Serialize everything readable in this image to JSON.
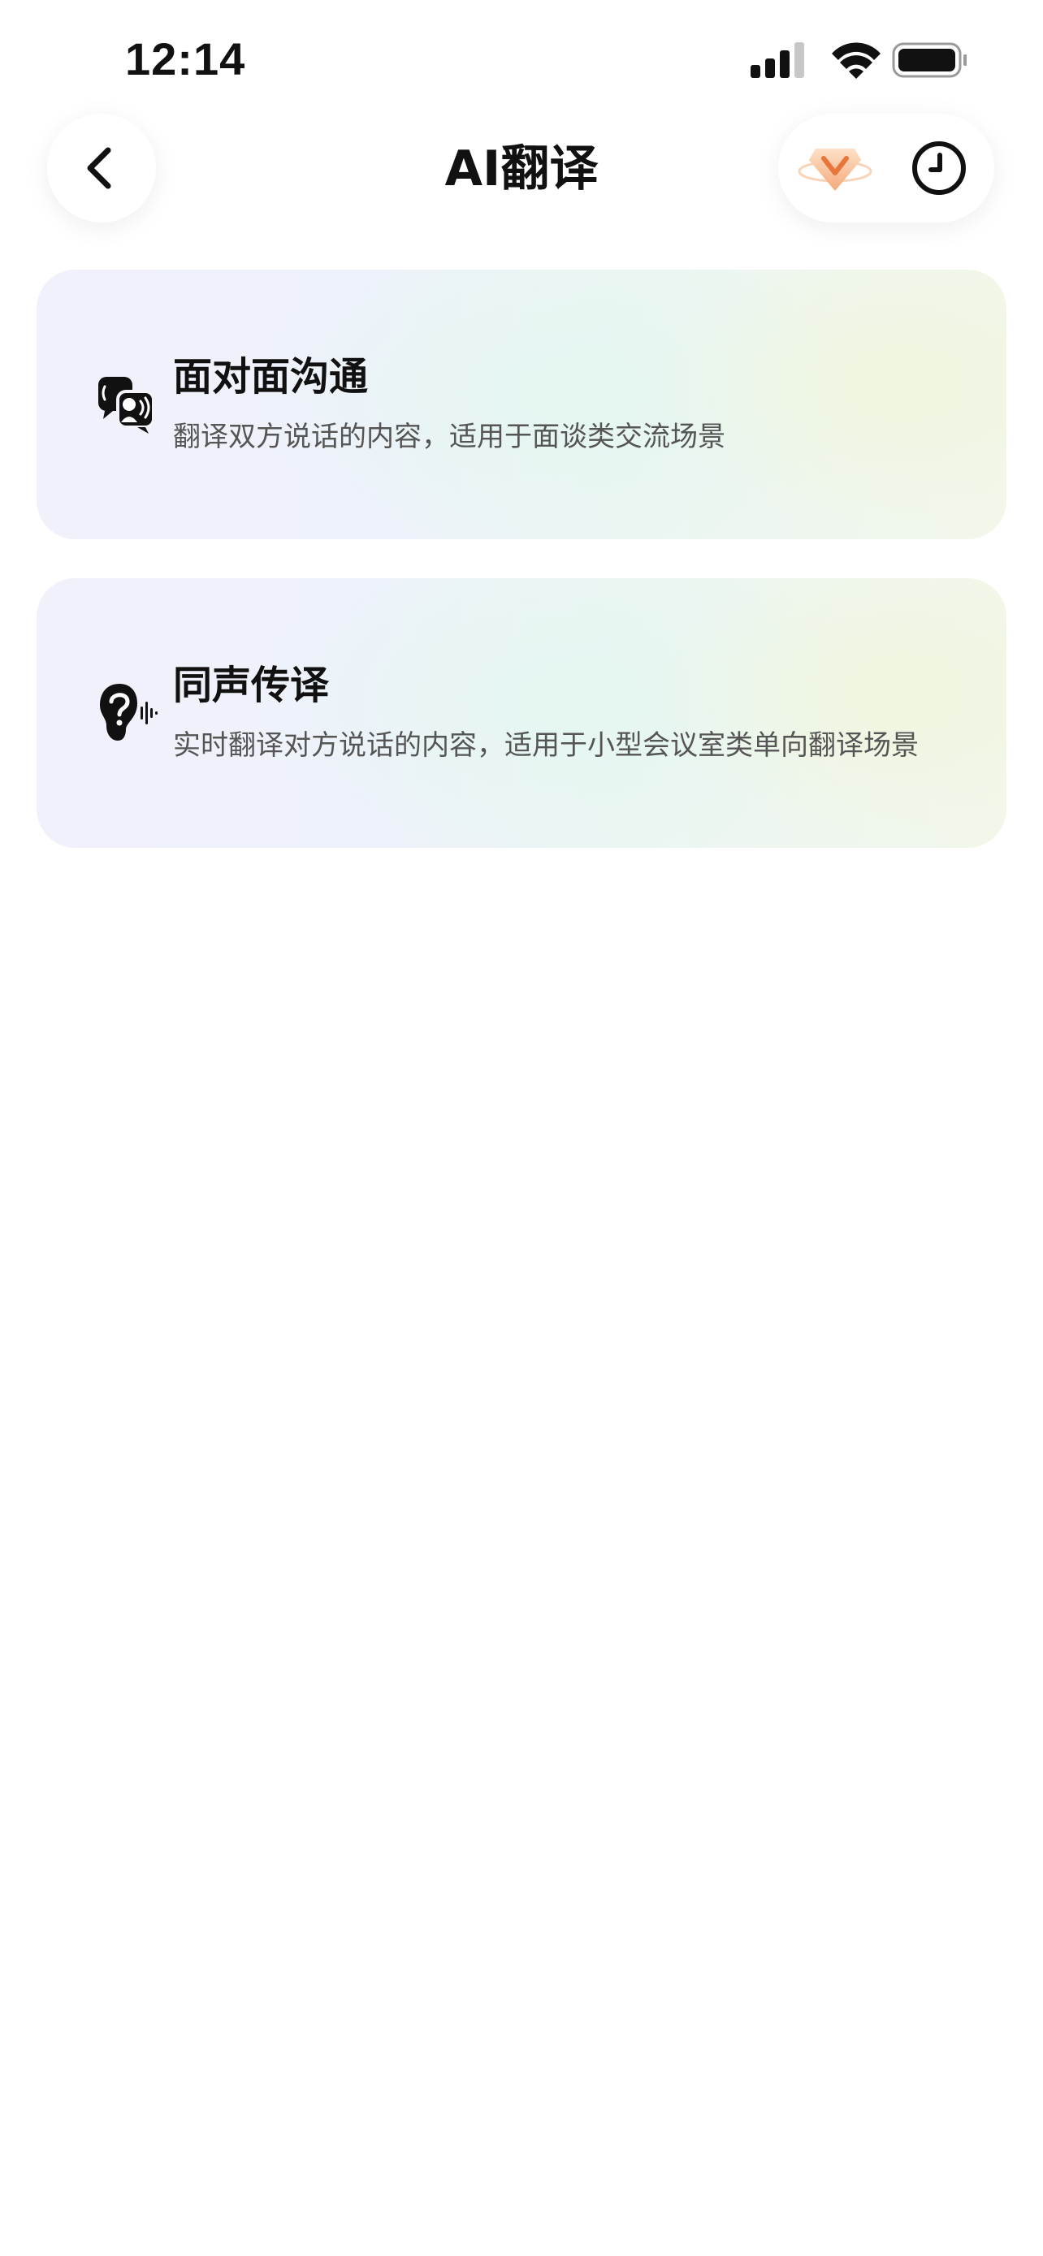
{
  "status_bar": {
    "time": "12:14",
    "icons": [
      "cellular-signal-icon",
      "wifi-icon",
      "battery-icon"
    ]
  },
  "header": {
    "title": "AI翻译",
    "back_icon": "chevron-left-icon",
    "vip_icon": "vip-crown-badge-icon",
    "history_icon": "clock-icon"
  },
  "modes": [
    {
      "title": "面对面沟通",
      "description": "翻译双方说话的内容，适用于面谈类交流场景",
      "icon": "face-to-face-speech-icon"
    },
    {
      "title": "同声传译",
      "description": "实时翻译对方说话的内容，适用于小型会议室类单向翻译场景",
      "icon": "ear-listening-icon"
    }
  ],
  "colors": {
    "text_primary": "#111111",
    "text_secondary": "#555555",
    "vip_accent": "#f4b48a"
  }
}
